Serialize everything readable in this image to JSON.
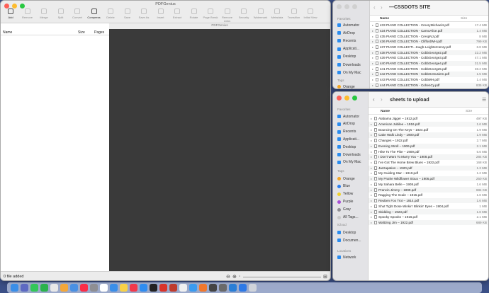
{
  "pdf": {
    "title": "PDFGenius",
    "subtitle": "PDFGenius",
    "toolbar": [
      {
        "label": "Add",
        "icon": "plus-icon",
        "enabled": true
      },
      {
        "label": "Remove",
        "icon": "minus-icon",
        "enabled": false
      },
      {
        "label": "Merge",
        "icon": "merge-icon",
        "enabled": false
      },
      {
        "label": "Split",
        "icon": "split-icon",
        "enabled": false
      },
      {
        "label": "Convert",
        "icon": "convert-icon",
        "enabled": false
      },
      {
        "label": "Compress",
        "icon": "compress-icon",
        "enabled": true
      },
      {
        "label": "Delete",
        "icon": "trash-icon",
        "enabled": false
      },
      {
        "label": "Save",
        "icon": "save-icon",
        "enabled": false
      },
      {
        "label": "Save As",
        "icon": "save-as-icon",
        "enabled": false
      },
      {
        "label": "Insert",
        "icon": "insert-icon",
        "enabled": false
      },
      {
        "label": "Extract",
        "icon": "extract-icon",
        "enabled": false
      },
      {
        "label": "Rotate",
        "icon": "rotate-icon",
        "enabled": false
      },
      {
        "label": "Page Break",
        "icon": "page-break-icon",
        "enabled": false
      },
      {
        "label": "Remove Links",
        "icon": "remove-links-icon",
        "enabled": false
      },
      {
        "label": "Security",
        "icon": "lock-icon",
        "enabled": false
      },
      {
        "label": "Watermark",
        "icon": "watermark-icon",
        "enabled": false
      },
      {
        "label": "Metadata",
        "icon": "metadata-icon",
        "enabled": false
      },
      {
        "label": "Transition",
        "icon": "transition-icon",
        "enabled": false
      },
      {
        "label": "Initial View",
        "icon": "initial-view-icon",
        "enabled": false
      }
    ],
    "columns": {
      "name": "Name",
      "size": "Size",
      "pages": "Pages"
    },
    "status": "0 file added"
  },
  "top_finder": {
    "title": "—CSSDOTS SITE",
    "sidebar": {
      "favorites_label": "Favorites",
      "items": [
        "Automator",
        "AirDrop",
        "Recents",
        "Applicati...",
        "Desktop",
        "Downloads",
        "On My Mac"
      ],
      "tags_label": "Tags",
      "tags": [
        {
          "name": "Orange",
          "color": "#f5a623"
        }
      ]
    },
    "columns": {
      "name": "Name",
      "size": "Size"
    },
    "files": [
      {
        "name": "433 PIANO COLLECTION - CreeryMichael4.pdf",
        "size": "17.4 MB"
      },
      {
        "name": "434 PIANO COLLECTION - CarnoAlice.pdf",
        "size": "1.4 MB"
      },
      {
        "name": "435 PIANO COLLECTION - CrespNJ.pdf",
        "size": "8 MB"
      },
      {
        "name": "436 PIANO COLLECTION - CliffordWH.pdf",
        "size": "799 KB"
      },
      {
        "name": "437 PIANO COLLECTI...tough-LeighterHenry.pdf",
        "size": "6.8 MB"
      },
      {
        "name": "438 PIANO COLLECTION - CobbGeorge2.pdf",
        "size": "22.2 MB"
      },
      {
        "name": "439 PIANO COLLECTION - CobbGeorge3.pdf",
        "size": "47.1 MB"
      },
      {
        "name": "440 PIANO COLLECTION - CobbGeorge4.pdf",
        "size": "31.5 MB"
      },
      {
        "name": "441 PIANO COLLECTION - CobbGeorge5.pdf",
        "size": "38.2 MB"
      },
      {
        "name": "442 PIANO COLLECTION - CobbGeSusiem.pdf",
        "size": "1.5 MB"
      },
      {
        "name": "443 PIANO COLLECTION - CobbMH.pdf",
        "size": "1.4 MB"
      },
      {
        "name": "444 PIANO COLLECTION - CohenCy.pdf",
        "size": "835 KB"
      }
    ]
  },
  "bottom_finder": {
    "title": "sheets to upload",
    "sidebar": {
      "favorites_label": "Favorites",
      "items": [
        "Automator",
        "AirDrop",
        "Recents",
        "Applicati...",
        "Desktop",
        "Downloads",
        "On My Mac"
      ],
      "tags_label": "Tags",
      "tags": [
        {
          "name": "Orange",
          "color": "#f5a623"
        },
        {
          "name": "Blue",
          "color": "#2a7ef0"
        },
        {
          "name": "Yellow",
          "color": "#f0d22a"
        },
        {
          "name": "Purple",
          "color": "#a64fd6"
        },
        {
          "name": "Gray",
          "color": "#8e8e93"
        },
        {
          "name": "All Tags...",
          "color": "#c8c8c8"
        }
      ],
      "icloud_label": "iCloud",
      "icloud": [
        "Desktop",
        "Documen..."
      ],
      "locations_label": "Locations",
      "locations": [
        "Network"
      ]
    },
    "columns": {
      "name": "Name",
      "size": "Size"
    },
    "files": [
      {
        "name": "Alabama Jigger – 1912.pdf",
        "size": "497 KB"
      },
      {
        "name": "American Jubilee – 1916.pdf",
        "size": "1.6 MB"
      },
      {
        "name": "Bouncing On The Keys – 1924.pdf",
        "size": "1.9 MB"
      },
      {
        "name": "Cake Walk Lindy – 1900.pdf",
        "size": "1.9 MB"
      },
      {
        "name": "Changes – 1922.pdf",
        "size": "2.7 MB"
      },
      {
        "name": "Evening Stroll – 1906.pdf",
        "size": "2.1 MB"
      },
      {
        "name": "Hike To The Pike – 1909.pdf",
        "size": "5.6 MB"
      },
      {
        "name": "I Don't Want To Marry You – 1908.pdf",
        "size": "284 KB"
      },
      {
        "name": "I've Got The Home Brew Blues – 1922.pdf",
        "size": "168 KB"
      },
      {
        "name": "Jazzapation – 1920.pdf",
        "size": "1.3 MB"
      },
      {
        "name": "My Guiding Star – 1910.pdf",
        "size": "1.2 MB"
      },
      {
        "name": "My Prairie Wildflower Sioux – 1906.pdf",
        "size": "250 KB"
      },
      {
        "name": "My Sahara Belle – 1908.pdf",
        "size": "1.6 MB"
      },
      {
        "name": "Prancin Jimmy – 1899.pdf",
        "size": "684 KB"
      },
      {
        "name": "Ragging The Scale – 1915.pdf",
        "size": "1.6 MB"
      },
      {
        "name": "Reuben Fox Trot – 1914.pdf",
        "size": "1.6 MB"
      },
      {
        "name": "Shut Tight Dose Winkin' Blinkin' Eyes – 1904.pdf",
        "size": "1 MB"
      },
      {
        "name": "Skidding – 1923.pdf",
        "size": "1.6 MB"
      },
      {
        "name": "Spooky Spooks – 1916.pdf",
        "size": "2.1 MB"
      },
      {
        "name": "Waltzing Jim – 1922.pdf",
        "size": "689 KB"
      }
    ]
  },
  "dock": {
    "apps": [
      {
        "name": "finder",
        "color": "#3a8ee8"
      },
      {
        "name": "launchpad",
        "color": "#5d6ac2"
      },
      {
        "name": "messages",
        "color": "#34c759"
      },
      {
        "name": "facetime",
        "color": "#2bb24c"
      },
      {
        "name": "chrome",
        "color": "#e8e8e8"
      },
      {
        "name": "photos",
        "color": "#f3a73a"
      },
      {
        "name": "preview",
        "color": "#4a90e2"
      },
      {
        "name": "music",
        "color": "#fa2d48"
      },
      {
        "name": "settings",
        "color": "#8e8e93"
      },
      {
        "name": "calendar",
        "color": "#ffffff"
      },
      {
        "name": "mail",
        "color": "#3a8ee8"
      },
      {
        "name": "notes",
        "color": "#f7d147"
      },
      {
        "name": "news",
        "color": "#f2394b"
      },
      {
        "name": "appstore",
        "color": "#2f8cf0"
      },
      {
        "name": "terminal",
        "color": "#222222"
      },
      {
        "name": "pdfgenius",
        "color": "#d9342b"
      },
      {
        "name": "filezilla",
        "color": "#bf3b2e"
      },
      {
        "name": "textedit",
        "color": "#f0f0f0"
      },
      {
        "name": "safari",
        "color": "#3a9bf0"
      },
      {
        "name": "firefox",
        "color": "#f0782e"
      },
      {
        "name": "sublime",
        "color": "#444444"
      },
      {
        "name": "mamp",
        "color": "#6a6a6a"
      },
      {
        "name": "vscode",
        "color": "#2a7ed6"
      },
      {
        "name": "dropbox",
        "color": "#2e79e6"
      },
      {
        "name": "trash",
        "color": "#cfd3da"
      }
    ]
  }
}
